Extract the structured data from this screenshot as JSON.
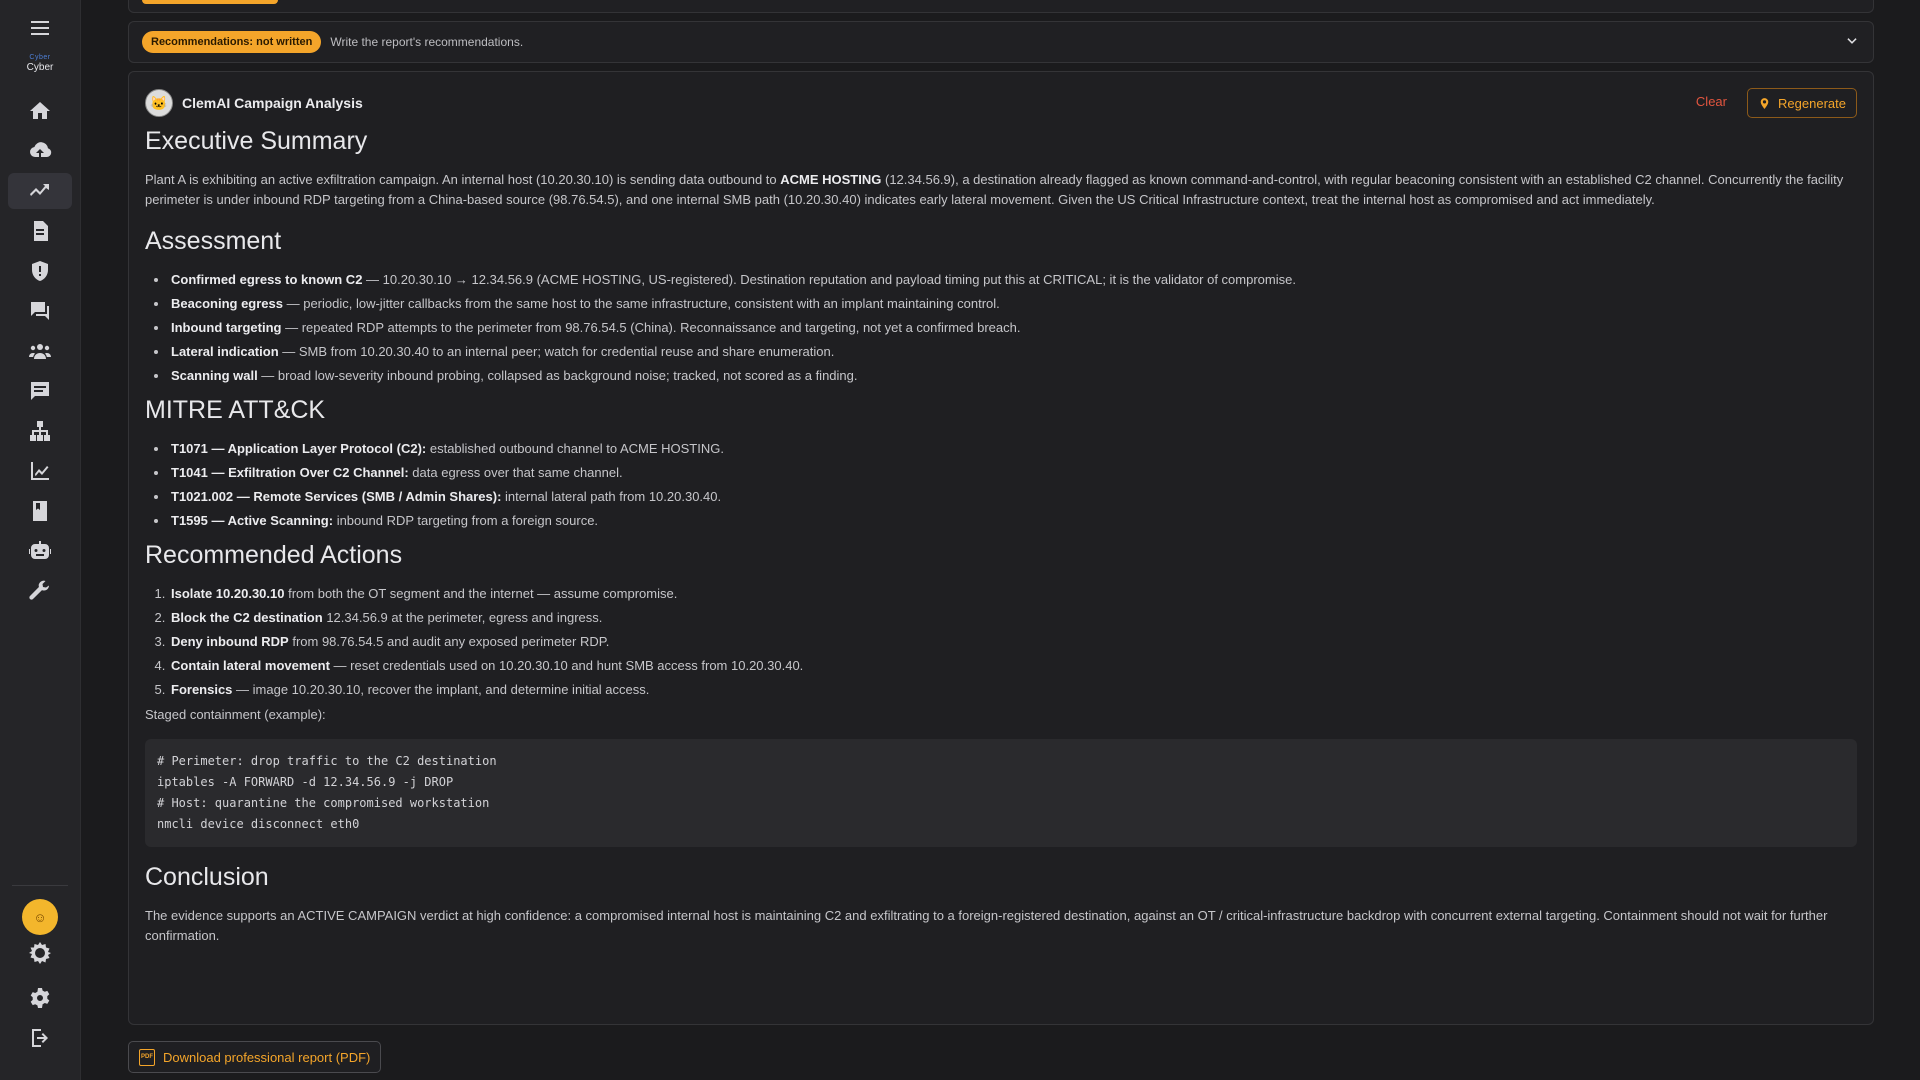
{
  "sidebar": {
    "logo_line1": "Cyber",
    "logo_line2": "Cyber",
    "items": [
      {
        "icon": "home-icon"
      },
      {
        "icon": "cloud-upload-icon"
      },
      {
        "icon": "analytics-icon"
      },
      {
        "icon": "document-icon"
      },
      {
        "icon": "shield-alert-icon"
      },
      {
        "icon": "chat-icon"
      },
      {
        "icon": "team-icon"
      },
      {
        "icon": "message-icon"
      },
      {
        "icon": "hierarchy-icon"
      },
      {
        "icon": "trend-chart-icon"
      },
      {
        "icon": "book-icon"
      },
      {
        "icon": "robot-icon"
      },
      {
        "icon": "wrench-icon"
      }
    ],
    "avatar_glyph": "☺"
  },
  "recommendations": {
    "badge": "Recommendations: not written",
    "hint": "Write the report's recommendations."
  },
  "report": {
    "title": "ClemAI Campaign Analysis",
    "clear_label": "Clear",
    "regenerate_label": "Regenerate",
    "exec_heading": "Executive Summary",
    "exec_a": "Plant A is exhibiting an active exfiltration campaign. An internal host (10.20.30.10) is sending data outbound to ",
    "exec_bold": "ACME HOSTING",
    "exec_b": " (12.34.56.9), a destination already flagged as known command-and-control, with regular beaconing consistent with an established C2 channel. Concurrently the facility perimeter is under inbound RDP targeting from a China-based source (98.76.54.5), and one internal SMB path (10.20.30.40) indicates early lateral movement. Given the US Critical Infrastructure context, treat the internal host as compromised and act immediately.",
    "assess_heading": "Assessment",
    "assessment": [
      {
        "b": "Confirmed egress to known C2",
        "t": " — 10.20.30.10 → 12.34.56.9 (ACME HOSTING, US-registered). Destination reputation and payload timing put this at CRITICAL; it is the validator of compromise."
      },
      {
        "b": "Beaconing egress",
        "t": " — periodic, low-jitter callbacks from the same host to the same infrastructure, consistent with an implant maintaining control."
      },
      {
        "b": "Inbound targeting",
        "t": " — repeated RDP attempts to the perimeter from 98.76.54.5 (China). Reconnaissance and targeting, not yet a confirmed breach."
      },
      {
        "b": "Lateral indication",
        "t": " — SMB from 10.20.30.40 to an internal peer; watch for credential reuse and share enumeration."
      },
      {
        "b": "Scanning wall",
        "t": " — broad low-severity inbound probing, collapsed as background noise; tracked, not scored as a finding."
      }
    ],
    "mitre_heading": "MITRE ATT&CK",
    "mitre": [
      {
        "b": "T1071 — Application Layer Protocol (C2):",
        "t": " established outbound channel to ACME HOSTING."
      },
      {
        "b": "T1041 — Exfiltration Over C2 Channel:",
        "t": " data egress over that same channel."
      },
      {
        "b": "T1021.002 — Remote Services (SMB / Admin Shares):",
        "t": " internal lateral path from 10.20.30.40."
      },
      {
        "b": "T1595 — Active Scanning:",
        "t": " inbound RDP targeting from a foreign source."
      }
    ],
    "actions_heading": "Recommended Actions",
    "actions": [
      {
        "b": "Isolate 10.20.30.10",
        "t": " from both the OT segment and the internet — assume compromise."
      },
      {
        "b": "Block the C2 destination",
        "t": " 12.34.56.9 at the perimeter, egress and ingress."
      },
      {
        "b": "Deny inbound RDP",
        "t": " from 98.76.54.5 and audit any exposed perimeter RDP."
      },
      {
        "b": "Contain lateral movement",
        "t": " — reset credentials used on 10.20.30.10 and hunt SMB access from 10.20.30.40."
      },
      {
        "b": "Forensics",
        "t": " — image 10.20.30.10, recover the implant, and determine initial access."
      }
    ],
    "staged_label": "Staged containment (example):",
    "code_lines": [
      "# Perimeter: drop traffic to the C2 destination",
      "iptables -A FORWARD -d 12.34.56.9 -j DROP",
      "# Host: quarantine the compromised workstation",
      "nmcli device disconnect eth0"
    ],
    "conclusion_heading": "Conclusion",
    "conclusion": "The evidence supports an ACTIVE CAMPAIGN verdict at high confidence: a compromised internal host is maintaining C2 and exfiltrating to a foreign-registered destination, against an OT / critical-infrastructure backdrop with concurrent external targeting. Containment should not wait for further confirmation."
  },
  "download_label": "Download professional report (PDF)",
  "colors": {
    "accent": "#f4a52a",
    "danger": "#e2553f",
    "background": "#1b1b1d"
  }
}
